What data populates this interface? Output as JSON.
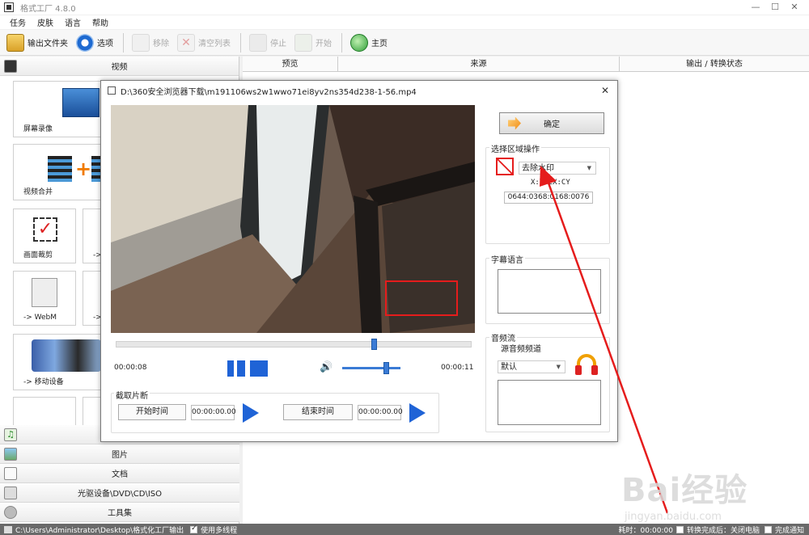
{
  "app": {
    "title": "格式工厂 4.8.0",
    "window_controls": [
      "—",
      "☐",
      "✕"
    ]
  },
  "menu": [
    "任务",
    "皮肤",
    "语言",
    "帮助"
  ],
  "toolbar": {
    "output_folder": "输出文件夹",
    "options": "选项",
    "remove": "移除",
    "clear_list": "清空列表",
    "stop": "停止",
    "start": "开始",
    "home": "主页"
  },
  "left": {
    "video_category": "视频",
    "tiles": [
      {
        "label": "屏幕录像"
      },
      {
        "label": "视频合并"
      },
      {
        "label": "画面裁剪"
      },
      {
        "label": "->"
      },
      {
        "label": "-> WebM"
      },
      {
        "label": "->"
      },
      {
        "label": "-> 移动设备"
      }
    ],
    "categories": [
      "图片",
      "文档",
      "光驱设备\\DVD\\CD\\ISO",
      "工具集"
    ]
  },
  "table": {
    "headers": [
      "预览",
      "来源",
      "输出 / 转换状态"
    ]
  },
  "status": {
    "path": "C:\\Users\\Administrator\\Desktop\\格式化工厂输出",
    "multithread": "使用多线程",
    "elapsed": "耗时：00:00:00",
    "after_done": "转换完成后：关闭电脑",
    "notify": "完成通知"
  },
  "dialog": {
    "title": "D:\\360安全浏览器下载\\m191106ws2w1wwo71ei8yv2ns354d238-1-56.mp4",
    "current_time": "00:00:08",
    "total_time": "00:00:11",
    "seek_position": 0.72,
    "volume_level": 0.75,
    "clip_section": "截取片断",
    "start_time_btn": "开始时间",
    "start_time_val": "00:00:00.00",
    "end_time_btn": "结束时间",
    "end_time_val": "00:00:00.00",
    "ok": "确定",
    "region_section": "选择区域操作",
    "region_mode": "去除水印",
    "region_format": "X:Y:CX:CY",
    "region_value": "0644:0368:0168:0076",
    "subtitle_section": "字幕语言",
    "audio_section": "音频流",
    "audio_channel_label": "源音频频道",
    "audio_channel_value": "默认"
  },
  "watermark": {
    "text": "Bai经验",
    "sub": "jingyan.baidu.com"
  },
  "colors": {
    "accent_blue": "#1f63d6",
    "annotation_red": "#e51c1c",
    "status_bar": "#6a6a6a"
  }
}
